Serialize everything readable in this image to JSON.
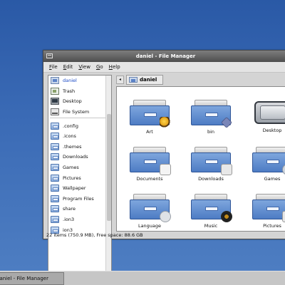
{
  "window": {
    "title": "daniel - File Manager"
  },
  "menubar": {
    "items": [
      "File",
      "Edit",
      "View",
      "Go",
      "Help"
    ]
  },
  "sidebar": {
    "places": [
      {
        "label": "daniel",
        "icon": "home-icon"
      },
      {
        "label": "Trash",
        "icon": "trash-icon"
      },
      {
        "label": "Desktop",
        "icon": "desktop-icon"
      },
      {
        "label": "File System",
        "icon": "filesystem-icon"
      }
    ],
    "bookmarks": [
      {
        "label": ".config",
        "icon": "folder-icon"
      },
      {
        "label": ".icons",
        "icon": "folder-icon"
      },
      {
        "label": ".themes",
        "icon": "folder-icon"
      },
      {
        "label": "Downloads",
        "icon": "folder-icon"
      },
      {
        "label": "Games",
        "icon": "folder-icon"
      },
      {
        "label": "Pictures",
        "icon": "folder-icon"
      },
      {
        "label": "Wallpaper",
        "icon": "folder-icon"
      },
      {
        "label": "Program Files",
        "icon": "folder-icon"
      },
      {
        "label": "share",
        "icon": "folder-icon"
      },
      {
        "label": ".ion3",
        "icon": "folder-icon"
      },
      {
        "label": "ion3",
        "icon": "folder-icon"
      }
    ]
  },
  "pathbar": {
    "back": "◂",
    "current": "daniel"
  },
  "content": {
    "items": [
      {
        "label": "Art",
        "icon": "art-folder-icon"
      },
      {
        "label": "bin",
        "icon": "bin-folder-icon"
      },
      {
        "label": "Desktop",
        "icon": "desktop-folder-icon"
      },
      {
        "label": "Documents",
        "icon": "documents-folder-icon"
      },
      {
        "label": "Downloads",
        "icon": "downloads-folder-icon"
      },
      {
        "label": "Games",
        "icon": "games-folder-icon"
      },
      {
        "label": "Language",
        "icon": "language-folder-icon"
      },
      {
        "label": "Music",
        "icon": "music-folder-icon"
      },
      {
        "label": "Pictures",
        "icon": "pictures-folder-icon"
      }
    ]
  },
  "statusbar": {
    "text": "22 items (750.9 MB), Free space: 88.6 GB"
  },
  "taskbar": {
    "button_label": "daniel - File Manager"
  }
}
